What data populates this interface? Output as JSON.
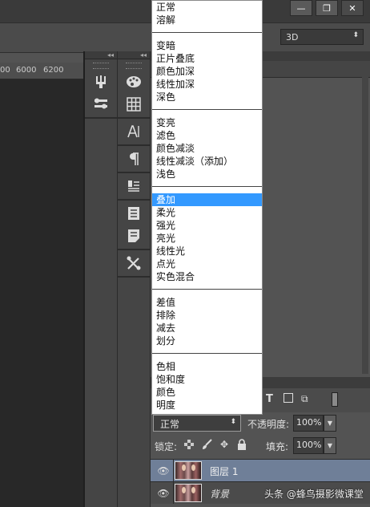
{
  "window": {
    "minimize": "—",
    "restore": "❐",
    "close": "✕"
  },
  "workspace": {
    "selected": "3D"
  },
  "ruler": {
    "ticks": [
      "00",
      "6000",
      "6200"
    ]
  },
  "blend_menu": {
    "groups": [
      [
        "正常",
        "溶解"
      ],
      [
        "变暗",
        "正片叠底",
        "颜色加深",
        "线性加深",
        "深色"
      ],
      [
        "变亮",
        "滤色",
        "颜色减淡",
        "线性减淡（添加）",
        "浅色"
      ],
      [
        "叠加",
        "柔光",
        "强光",
        "亮光",
        "线性光",
        "点光",
        "实色混合"
      ],
      [
        "差值",
        "排除",
        "减去",
        "划分"
      ],
      [
        "色相",
        "饱和度",
        "颜色",
        "明度"
      ]
    ],
    "highlighted": "叠加"
  },
  "layers_panel": {
    "blend_mode_value": "正常",
    "opacity_label": "不透明度:",
    "opacity_value": "100%",
    "lock_label": "锁定:",
    "fill_label": "填充:",
    "fill_value": "100%",
    "layers": [
      {
        "name": "图层 1",
        "selected": true
      },
      {
        "name": "背景",
        "selected": false
      }
    ]
  },
  "watermark": "头条 @蜂鸟摄影微课堂",
  "colors": {
    "menu_highlight": "#3399ff",
    "selected_layer": "#6f7f98",
    "panel_bg": "#535353"
  }
}
